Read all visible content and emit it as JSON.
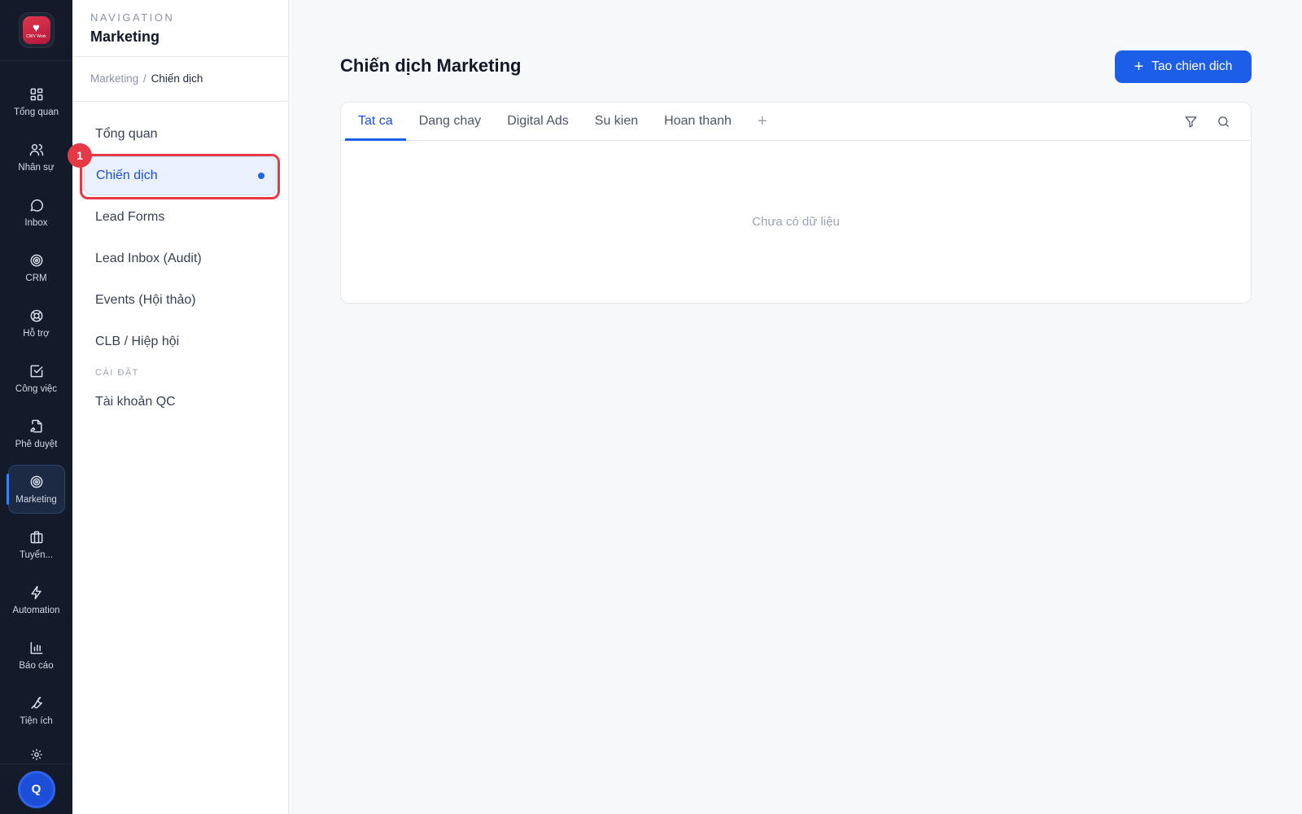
{
  "app": {
    "logo_label": "CWV Work"
  },
  "rail": {
    "items": [
      {
        "label": "Tổng quan",
        "icon": "grid-icon"
      },
      {
        "label": "Nhân sự",
        "icon": "users-icon"
      },
      {
        "label": "Inbox",
        "icon": "chat-icon"
      },
      {
        "label": "CRM",
        "icon": "target-icon"
      },
      {
        "label": "Hỗ trợ",
        "icon": "lifebuoy-icon"
      },
      {
        "label": "Công việc",
        "icon": "checkbox-icon"
      },
      {
        "label": "Phê duyệt",
        "icon": "file-sign-icon"
      },
      {
        "label": "Marketing",
        "icon": "target-icon",
        "active": true
      },
      {
        "label": "Tuyển...",
        "icon": "briefcase-icon"
      },
      {
        "label": "Automation",
        "icon": "lightning-icon"
      },
      {
        "label": "Báo cáo",
        "icon": "bar-chart-icon"
      },
      {
        "label": "Tiện ích",
        "icon": "wrench-icon"
      }
    ],
    "avatar_initial": "Q"
  },
  "nav": {
    "eyebrow": "NAVIGATION",
    "title": "Marketing",
    "breadcrumb": {
      "parent": "Marketing",
      "separator": "/",
      "current": "Chiến dịch"
    },
    "items": [
      {
        "label": "Tổng quan"
      },
      {
        "label": "Chiến dịch",
        "active": true
      },
      {
        "label": "Lead Forms"
      },
      {
        "label": "Lead Inbox (Audit)"
      },
      {
        "label": "Events (Hội thảo)"
      },
      {
        "label": "CLB / Hiệp hội"
      }
    ],
    "section_label": "CÀI ĐẶT",
    "settings_items": [
      {
        "label": "Tài khoản QC"
      }
    ],
    "step_badge": "1"
  },
  "main": {
    "title": "Chiến dịch Marketing",
    "create_button": "Tao chien dich",
    "tabs": [
      {
        "label": "Tat ca",
        "active": true
      },
      {
        "label": "Dang chay"
      },
      {
        "label": "Digital Ads"
      },
      {
        "label": "Su kien"
      },
      {
        "label": "Hoan thanh"
      }
    ],
    "add_tab": "+",
    "empty_text": "Chưa có dữ liệu"
  },
  "colors": {
    "rail_bg": "#131a2a",
    "accent": "#1d5ee8",
    "highlight": "#e53945"
  }
}
